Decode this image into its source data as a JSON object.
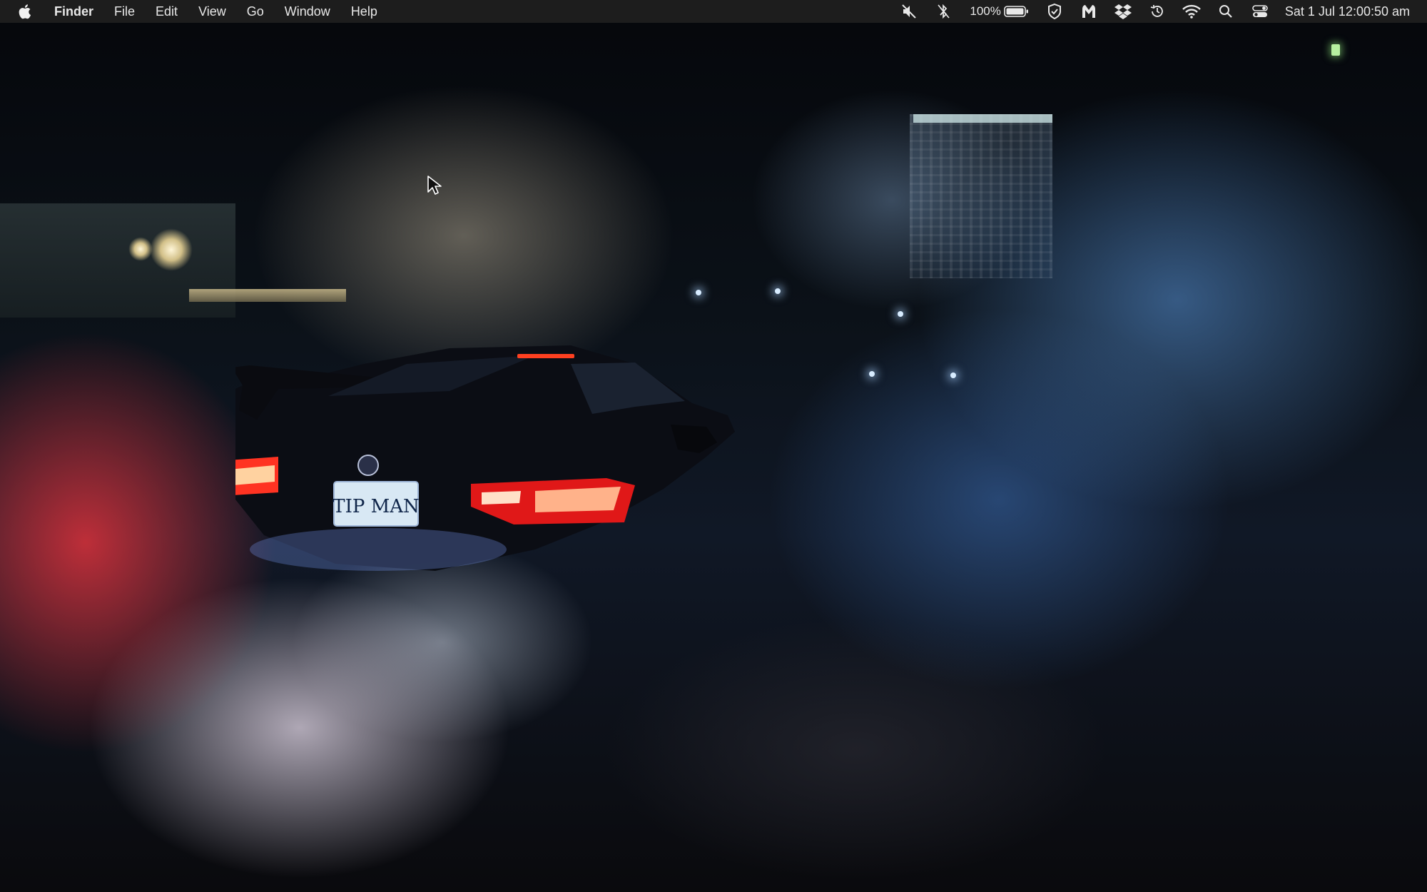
{
  "menubar": {
    "apple_icon": "apple-logo-icon",
    "app_name": "Finder",
    "items": [
      {
        "label": "File"
      },
      {
        "label": "Edit"
      },
      {
        "label": "View"
      },
      {
        "label": "Go"
      },
      {
        "label": "Window"
      },
      {
        "label": "Help"
      }
    ],
    "status": {
      "icons": [
        "mute-icon",
        "bluetooth-off-icon",
        "battery-icon",
        "vpn-shield-icon",
        "malwarebytes-icon",
        "dropbox-icon",
        "time-machine-icon",
        "wifi-icon",
        "spotlight-search-icon",
        "control-center-icon"
      ],
      "battery_percent": "100%",
      "battery_level": 1.0,
      "clock": "Sat 1 Jul  12:00:50 am"
    },
    "colors": {
      "bar_background": "#1e1e1e",
      "text": "#e8e8e8"
    }
  },
  "desktop": {
    "wallpaper": "car-burnout-smoke-night-wallpaper",
    "license_plate": "TIP MAN",
    "cursor_icon": "pointer-arrow-icon"
  }
}
